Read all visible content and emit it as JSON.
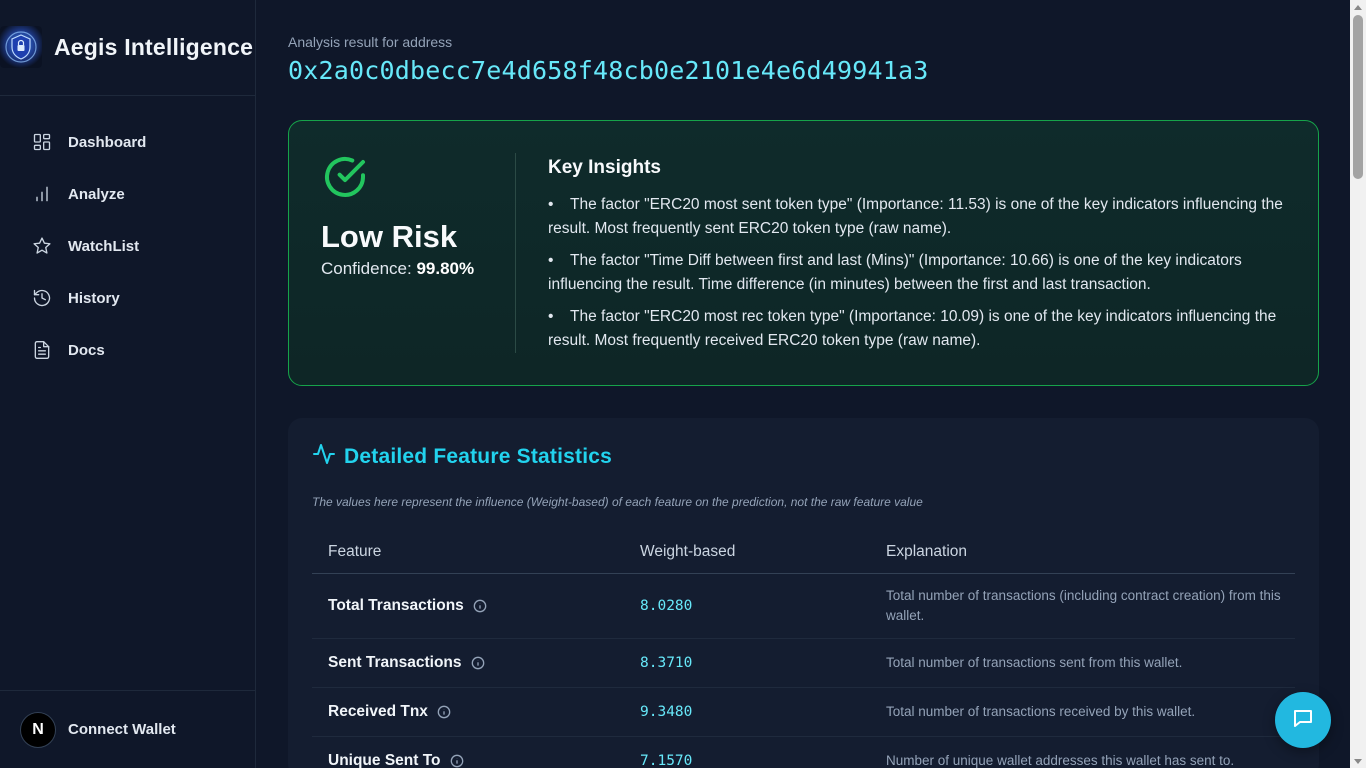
{
  "app": {
    "title": "Aegis Intelligence"
  },
  "sidebar": {
    "items": [
      {
        "label": "Dashboard",
        "icon": "dashboard-icon"
      },
      {
        "label": "Analyze",
        "icon": "bar-chart-icon"
      },
      {
        "label": "WatchList",
        "icon": "star-icon"
      },
      {
        "label": "History",
        "icon": "history-icon"
      },
      {
        "label": "Docs",
        "icon": "document-icon"
      }
    ],
    "wallet": {
      "avatar_letter": "N",
      "label": "Connect Wallet"
    }
  },
  "result": {
    "caption": "Analysis result for address",
    "address": "0x2a0c0dbecc7e4d658f48cb0e2101e4e6d49941a3"
  },
  "risk": {
    "level": "Low Risk",
    "confidence_label": "Confidence:",
    "confidence_value": "99.80%",
    "accent_color": "#22c55e"
  },
  "insights": {
    "title": "Key Insights",
    "items": [
      "The factor \"ERC20 most sent token type\" (Importance: 11.53) is one of the key indicators influencing the result. Most frequently sent ERC20 token type (raw name).",
      "The factor \"Time Diff between first and last (Mins)\" (Importance: 10.66) is one of the key indicators influencing the result. Time difference (in minutes) between the first and last transaction.",
      "The factor \"ERC20 most rec token type\" (Importance: 10.09) is one of the key indicators influencing the result. Most frequently received ERC20 token type (raw name)."
    ]
  },
  "stats": {
    "title": "Detailed Feature Statistics",
    "note": "The values here represent the influence (Weight-based) of each feature on the prediction, not the raw feature value",
    "columns": [
      "Feature",
      "Weight-based",
      "Explanation"
    ],
    "rows": [
      {
        "feature": "Total Transactions",
        "weight": "8.0280",
        "explanation": "Total number of transactions (including contract creation) from this wallet."
      },
      {
        "feature": "Sent Transactions",
        "weight": "8.3710",
        "explanation": "Total number of transactions sent from this wallet."
      },
      {
        "feature": "Received Tnx",
        "weight": "9.3480",
        "explanation": "Total number of transactions received by this wallet."
      },
      {
        "feature": "Unique Sent To",
        "weight": "7.1570",
        "explanation": "Number of unique wallet addresses this wallet has sent to."
      }
    ]
  },
  "chat": {
    "icon": "chat-icon",
    "color": "#22b8e0"
  }
}
